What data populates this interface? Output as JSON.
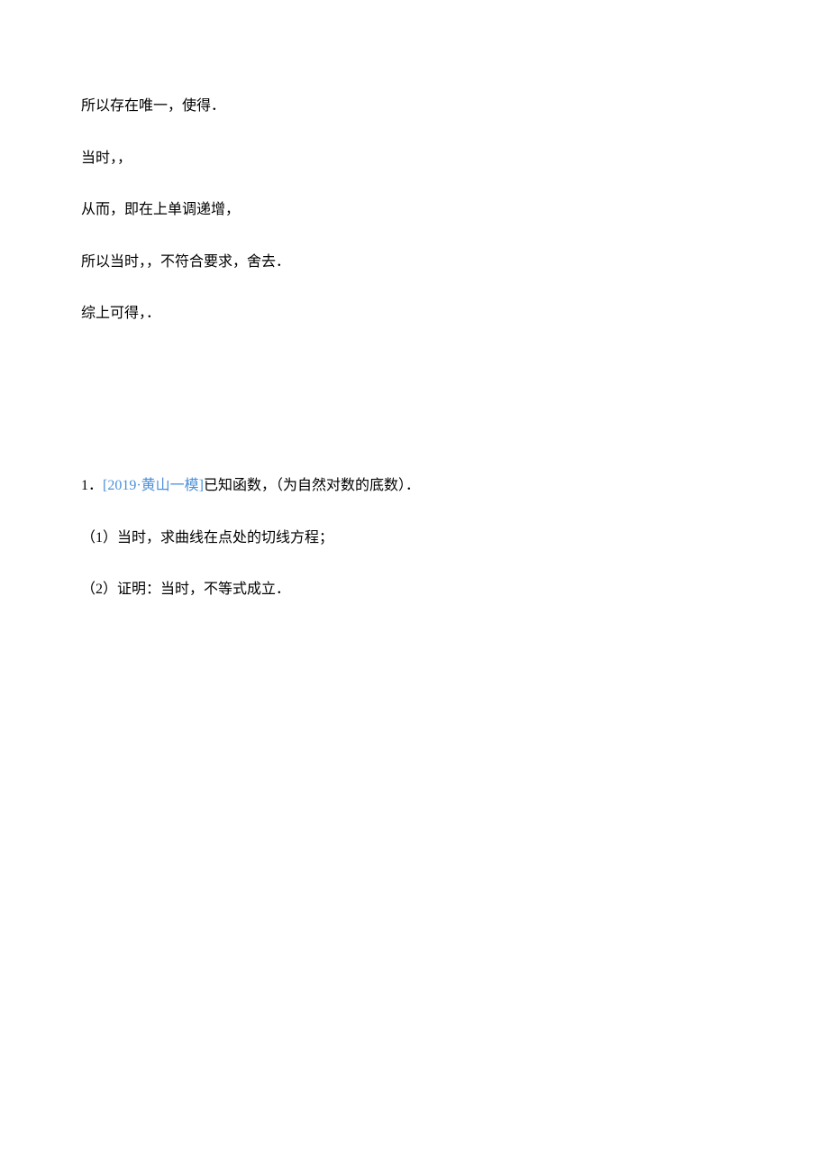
{
  "paragraphs": {
    "p1": "所以存在唯一，使得．",
    "p2": "当时，，",
    "p3": "从而，即在上单调递增，",
    "p4": "所以当时，，不符合要求，舍去．",
    "p5": "综上可得，．"
  },
  "problem": {
    "number": "1．",
    "citation": "[2019·黄山一模]",
    "text": "已知函数，（为自然对数的底数）．",
    "sub1": "（1）当时，求曲线在点处的切线方程；",
    "sub2": "（2）证明：当时，不等式成立．"
  }
}
